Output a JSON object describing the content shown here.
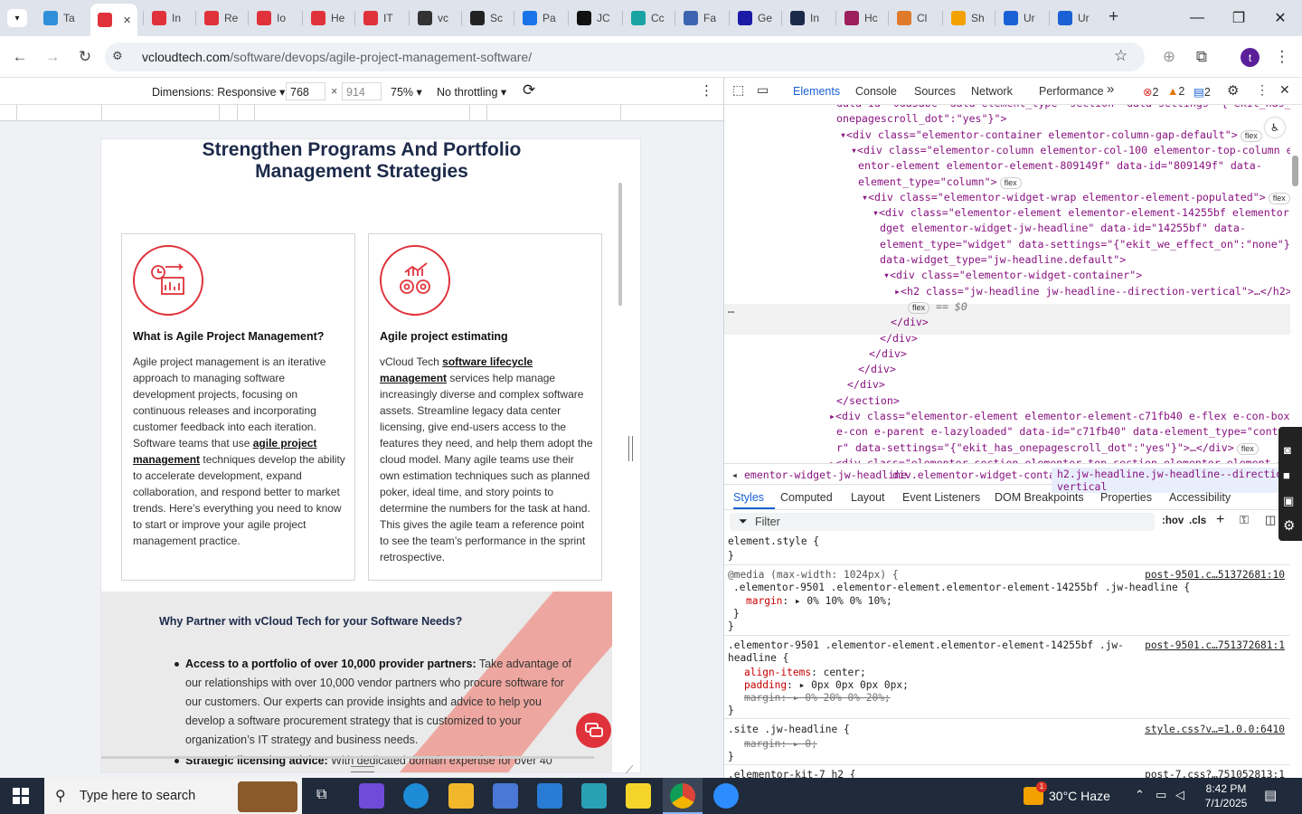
{
  "browser": {
    "tabs": [
      {
        "label": "Ta",
        "color": "#2f8fd8"
      },
      {
        "label": "",
        "color": "#e0323b"
      },
      {
        "label": "In",
        "color": "#e0323b"
      },
      {
        "label": "Re",
        "color": "#e0323b"
      },
      {
        "label": "Io",
        "color": "#e0323b"
      },
      {
        "label": "He",
        "color": "#e0323b"
      },
      {
        "label": "IT",
        "color": "#e0323b"
      },
      {
        "label": "vc",
        "color": "#333333"
      },
      {
        "label": "Sc",
        "color": "#222222"
      },
      {
        "label": "Pa",
        "color": "#1a73e8"
      },
      {
        "label": "JC",
        "color": "#111111"
      },
      {
        "label": "Cc",
        "color": "#1aa3a3"
      },
      {
        "label": "Fa",
        "color": "#3d64b0"
      },
      {
        "label": "Ge",
        "color": "#1a1aa6"
      },
      {
        "label": "In",
        "color": "#1c2a4a"
      },
      {
        "label": "Hc",
        "color": "#9c1e5c"
      },
      {
        "label": "Cl",
        "color": "#e07a2b"
      },
      {
        "label": "Sh",
        "color": "#f2a100"
      },
      {
        "label": "Ur",
        "color": "#1a61d5"
      },
      {
        "label": "Ur",
        "color": "#1a61d5"
      }
    ],
    "new_tab": "+",
    "url_host": "vcloudtech.com",
    "url_path": "/software/devops/agile-project-management-software/",
    "profile_initial": "t"
  },
  "device_toolbar": {
    "dimensions_label": "Dimensions: Responsive",
    "width": "768",
    "times": "×",
    "height": "914",
    "zoom": "75%",
    "throttling": "No throttling"
  },
  "page": {
    "title": "Strengthen Programs And Portfolio Management Strategies",
    "cards": [
      {
        "heading": "What is Agile Project Management?",
        "text_before": "Agile project management is an iterative approach to managing software development projects, focusing on continuous releases and incorporating customer feedback into each iteration. Software teams that use ",
        "link": "agile project management",
        "text_after": " techniques develop the ability to accelerate development, expand collaboration, and respond better to market trends. Here’s everything you need to know to start or improve your agile project management practice."
      },
      {
        "heading": "Agile project estimating",
        "text_before": "vCloud Tech ",
        "link": "software lifecycle management",
        "text_after": " services help manage increasingly diverse and complex software assets. Streamline legacy data center licensing, give end-users access to the features they need, and help them adopt the cloud model. Many agile teams use their own estimation techniques such as planned poker, ideal time, and story points to determine the numbers for the task at hand. This gives the agile team a reference point to see the team’s performance in the sprint retrospective."
      }
    ],
    "partner": {
      "title": "Why Partner with vCloud Tech for your Software Needs?",
      "item1_bold": "Access to a portfolio of over 10,000 provider partners:",
      "item1_text": " Take advantage of our relationships with over 10,000 vendor partners who procure software for our customers. Our experts can provide insights and advice to help you develop a software procurement strategy that is customized to your organization’s IT strategy and business needs.",
      "item2_bold": "Strategic licensing advice:",
      "item2_text": " With dedicated domain expertise for over 40"
    }
  },
  "devtools": {
    "tabs": [
      "Elements",
      "Console",
      "Sources",
      "Network",
      "Performance"
    ],
    "more": "»",
    "errors": "2",
    "warnings": "2",
    "messages": "2",
    "dom_lines": [
      {
        "indent": 124,
        "text": "data-id=\"0da3abc\" data-element_type=\"section\" data-settings=\"{\"ekit_has_"
      },
      {
        "indent": 124,
        "text": "onepagescroll_dot\":\"yes\"}\">"
      },
      {
        "indent": 128,
        "text": "▾<div class=\"elementor-container elementor-column-gap-default\">",
        "badge": "flex"
      },
      {
        "indent": 140,
        "text": "▾<div class=\"elementor-column elementor-col-100 elementor-top-column elem"
      },
      {
        "indent": 148,
        "text": "entor-element elementor-element-809149f\" data-id=\"809149f\" data-"
      },
      {
        "indent": 148,
        "text": "element_type=\"column\">",
        "badge": "flex"
      },
      {
        "indent": 152,
        "text": "▾<div class=\"elementor-widget-wrap elementor-element-populated\">",
        "badge": "flex"
      },
      {
        "indent": 164,
        "text": "▾<div class=\"elementor-element elementor-element-14255bf elementor-wi"
      },
      {
        "indent": 172,
        "text": "dget elementor-widget-jw-headline\" data-id=\"14255bf\" data-"
      },
      {
        "indent": 172,
        "text": "element_type=\"widget\" data-settings=\"{\"ekit_we_effect_on\":\"none\"}\""
      },
      {
        "indent": 172,
        "text": "data-widget_type=\"jw-headline.default\">"
      },
      {
        "indent": 176,
        "text": "▾<div class=\"elementor-widget-container\">"
      },
      {
        "indent": 188,
        "text": "▸<h2 class=\"jw-headline jw-headline--direction-vertical\">…</h2>"
      },
      {
        "indent": 200,
        "text": "",
        "badge": "flex",
        "suffix": " == $0"
      },
      {
        "indent": 184,
        "text": "</div>"
      },
      {
        "indent": 172,
        "text": "</div>"
      },
      {
        "indent": 160,
        "text": "</div>"
      },
      {
        "indent": 148,
        "text": "</div>"
      },
      {
        "indent": 136,
        "text": "</div>"
      },
      {
        "indent": 124,
        "text": "</section>"
      },
      {
        "indent": 116,
        "text": "▸<div class=\"elementor-element elementor-element-c71fb40 e-flex e-con-boxed"
      },
      {
        "indent": 124,
        "text": "e-con e-parent e-lazyloaded\" data-id=\"c71fb40\" data-element_type=\"containe"
      },
      {
        "indent": 124,
        "text": "r\" data-settings=\"{\"ekit_has_onepagescroll_dot\":\"yes\"}\">…</div>",
        "badge": "flex"
      },
      {
        "indent": 116,
        "text": "▸<div class=\"elementor-section elementor-top-section elementor-element elem"
      }
    ],
    "breadcrumbs": [
      "ementor-widget-jw-headline",
      "div.elementor-widget-container",
      "h2.jw-headline.jw-headline--direction-vertical"
    ],
    "style_tabs": [
      "Styles",
      "Computed",
      "Layout",
      "Event Listeners",
      "DOM Breakpoints",
      "Properties",
      "Accessibility"
    ],
    "filter_placeholder": "Filter",
    "hov": ":hov",
    "cls": ".cls",
    "rules": {
      "r1a": "element.style {",
      "r1b": "}",
      "r2media": "@media (max-width: 1024px) {",
      "r2src": "post-9501.c…51372681:10",
      "r2sel": ".elementor-9501 .elementor-element.elementor-element-14255bf .jw-headline {",
      "r2prop": "margin",
      "r2val": "▸ 0% 10% 0% 10%;",
      "r2end": "}",
      "r2end2": "}",
      "r3sel1": ".elementor-9501 .elementor-element.elementor-element-14255bf .jw-",
      "r3sel2": "headline {",
      "r3src": "post-9501.c…751372681:1",
      "r3p1": "align-items",
      "r3v1": "center;",
      "r3p2": "padding",
      "r3v2": "▸ 0px 0px 0px 0px;",
      "r3p3": "margin",
      "r3v3": "▸ 0% 20% 0% 20%;",
      "r3end": "}",
      "r4sel": ".site .jw-headline {",
      "r4src": "style.css?v…=1.0.0:6410",
      "r4p1": "margin",
      "r4v1": "▸ 0;",
      "r4end": "}",
      "r5sel": ".elementor-kit-7 h2 {",
      "r5src": "post-7.css?…751052813:1"
    }
  },
  "taskbar": {
    "search_placeholder": "Type here to search",
    "weather": "30°C  Haze",
    "time": "8:42 PM",
    "date": "7/1/2025",
    "notify": "1"
  }
}
